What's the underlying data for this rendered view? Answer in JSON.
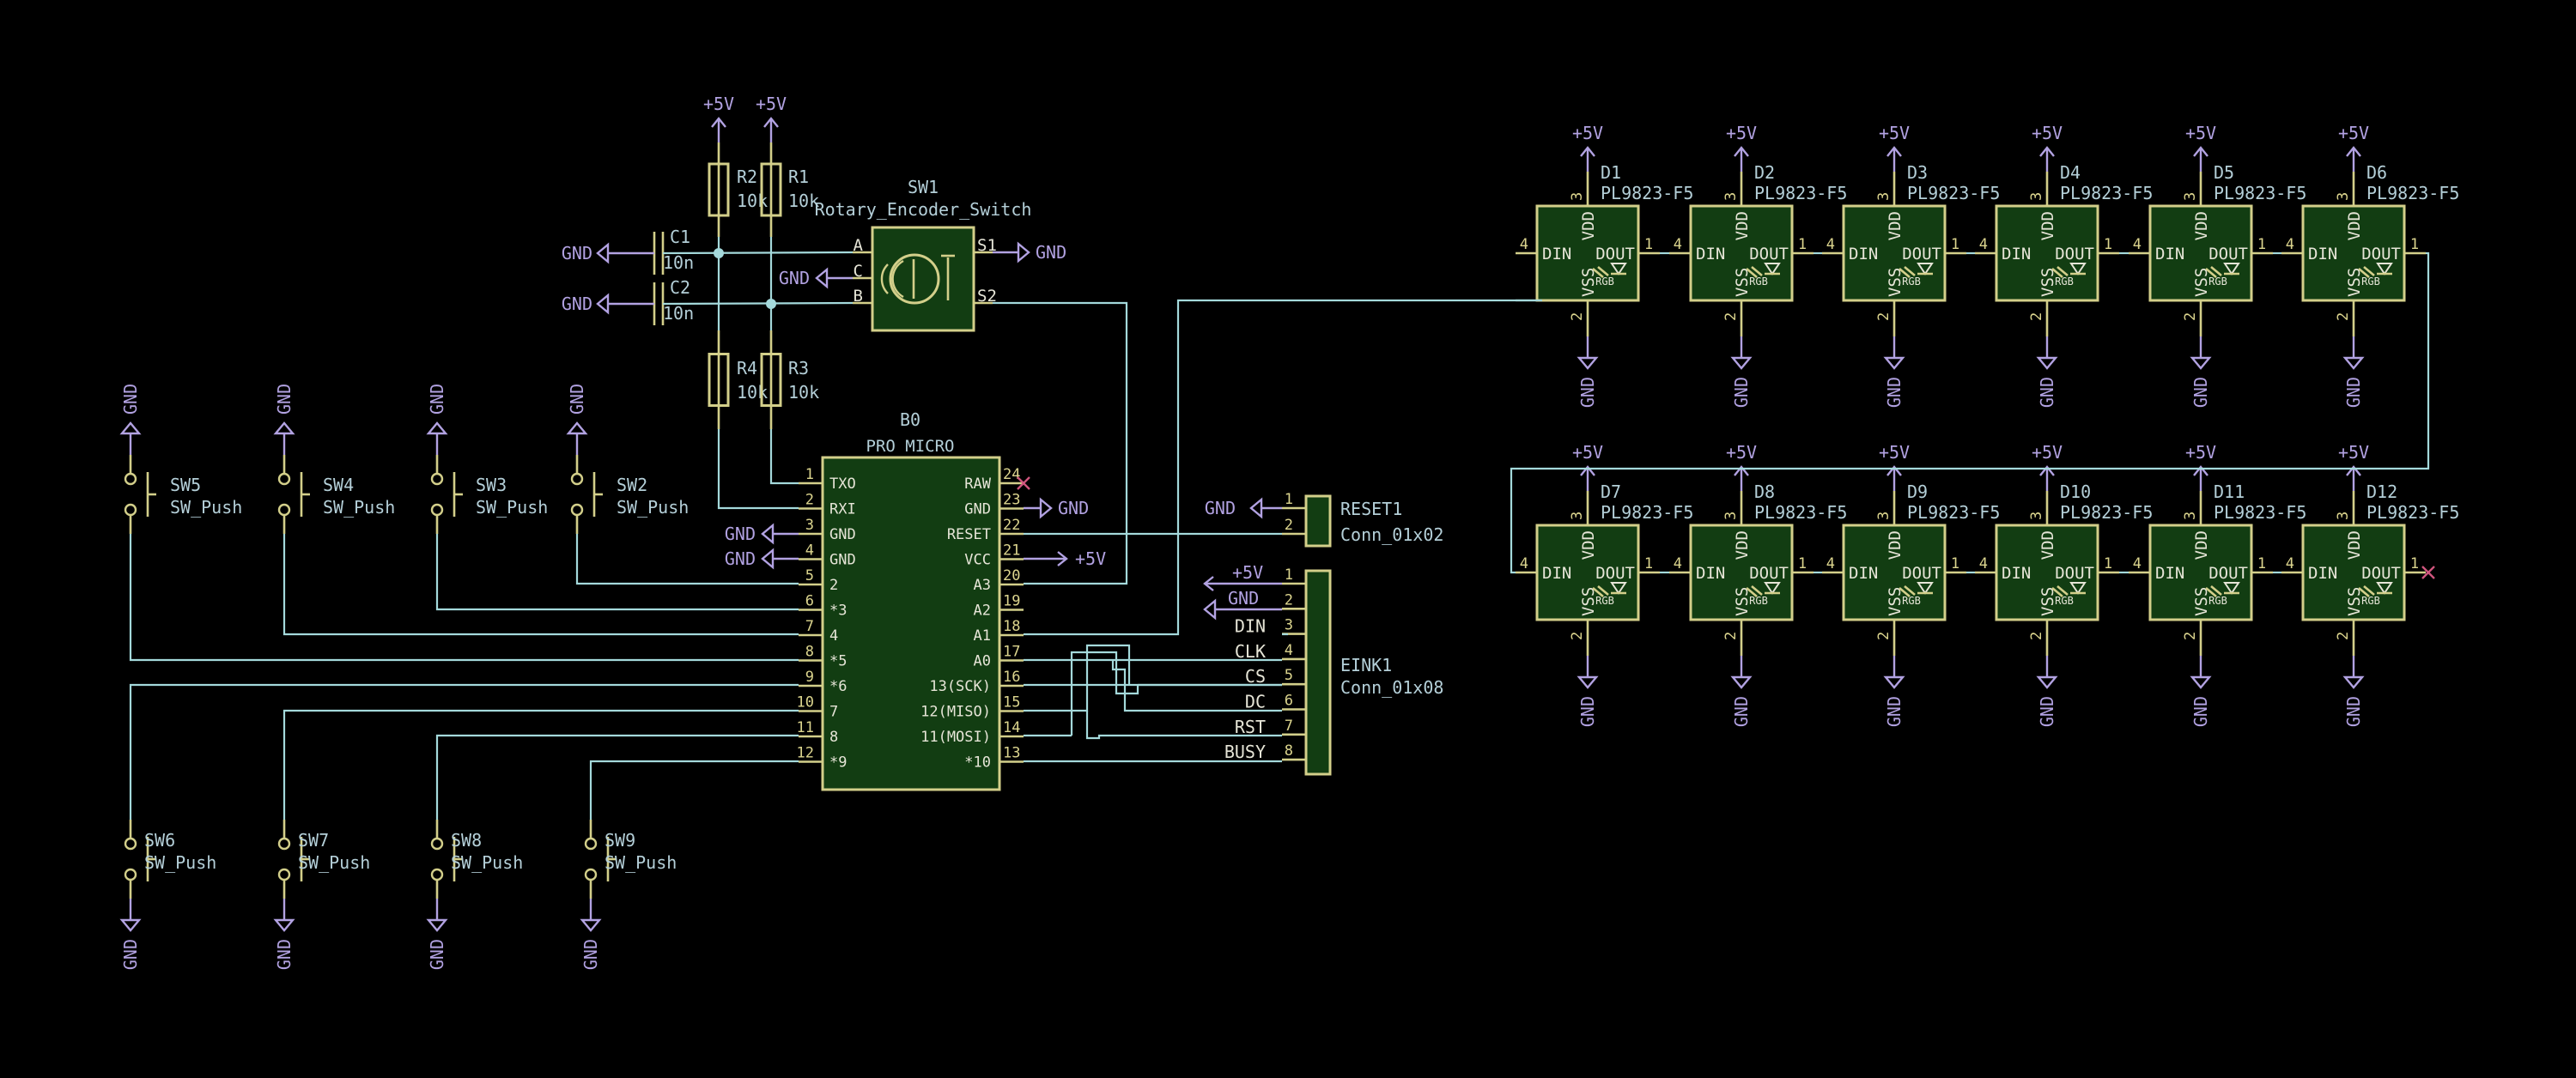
{
  "colors": {
    "background": "#000000",
    "wire": "#a4d9db",
    "component_outline": "#d3cf8a",
    "component_fill": "#123d12",
    "power_symbol": "#b2a2e2",
    "reference_text": "#b4cfd8",
    "pin_text": "#e6e5d7",
    "no_connect": "#d0567e"
  },
  "mcu": {
    "ref": "B0",
    "value": "PRO MICRO",
    "left_pins": [
      {
        "num": "1",
        "name": "TXO"
      },
      {
        "num": "2",
        "name": "RXI"
      },
      {
        "num": "3",
        "name": "GND"
      },
      {
        "num": "4",
        "name": "GND"
      },
      {
        "num": "5",
        "name": "2"
      },
      {
        "num": "6",
        "name": "*3"
      },
      {
        "num": "7",
        "name": "4"
      },
      {
        "num": "8",
        "name": "*5"
      },
      {
        "num": "9",
        "name": "*6"
      },
      {
        "num": "10",
        "name": "7"
      },
      {
        "num": "11",
        "name": "8"
      },
      {
        "num": "12",
        "name": "*9"
      }
    ],
    "right_pins": [
      {
        "num": "24",
        "name": "RAW"
      },
      {
        "num": "23",
        "name": "GND"
      },
      {
        "num": "22",
        "name": "RESET"
      },
      {
        "num": "21",
        "name": "VCC"
      },
      {
        "num": "20",
        "name": "A3"
      },
      {
        "num": "19",
        "name": "A2"
      },
      {
        "num": "18",
        "name": "A1"
      },
      {
        "num": "17",
        "name": "A0"
      },
      {
        "num": "16",
        "name": "13(SCK)"
      },
      {
        "num": "15",
        "name": "12(MISO)"
      },
      {
        "num": "14",
        "name": "11(MOSI)"
      },
      {
        "num": "13",
        "name": "*10"
      }
    ]
  },
  "encoder": {
    "ref": "SW1",
    "value": "Rotary_Encoder_Switch",
    "pins": {
      "a": "A",
      "c": "C",
      "b": "B",
      "s1": "S1",
      "s2": "S2"
    }
  },
  "resistors": [
    {
      "ref": "R2",
      "value": "10k"
    },
    {
      "ref": "R1",
      "value": "10k"
    },
    {
      "ref": "R4",
      "value": "10k"
    },
    {
      "ref": "R3",
      "value": "10k"
    }
  ],
  "capacitors": [
    {
      "ref": "C1",
      "value": "10n"
    },
    {
      "ref": "C2",
      "value": "10n"
    }
  ],
  "switches": [
    {
      "ref": "SW5",
      "value": "SW_Push"
    },
    {
      "ref": "SW4",
      "value": "SW_Push"
    },
    {
      "ref": "SW3",
      "value": "SW_Push"
    },
    {
      "ref": "SW2",
      "value": "SW_Push"
    },
    {
      "ref": "SW6",
      "value": "SW_Push"
    },
    {
      "ref": "SW7",
      "value": "SW_Push"
    },
    {
      "ref": "SW8",
      "value": "SW_Push"
    },
    {
      "ref": "SW9",
      "value": "SW_Push"
    }
  ],
  "reset_connector": {
    "ref": "RESET1",
    "value": "Conn_01x02",
    "pins": [
      "1",
      "2"
    ]
  },
  "eink_connector": {
    "ref": "EINK1",
    "value": "Conn_01x08",
    "pins": [
      {
        "num": "1",
        "net": "+5V"
      },
      {
        "num": "2",
        "net": "GND"
      },
      {
        "num": "3",
        "net": "DIN"
      },
      {
        "num": "4",
        "net": "CLK"
      },
      {
        "num": "5",
        "net": "CS"
      },
      {
        "num": "6",
        "net": "DC"
      },
      {
        "num": "7",
        "net": "RST"
      },
      {
        "num": "8",
        "net": "BUSY"
      }
    ]
  },
  "leds": {
    "value": "PL9823-F5",
    "refs": [
      "D1",
      "D2",
      "D3",
      "D4",
      "D5",
      "D6",
      "D7",
      "D8",
      "D9",
      "D10",
      "D11",
      "D12"
    ],
    "pins": {
      "din": "DIN",
      "dout": "DOUT",
      "vdd": "VDD",
      "vss": "VSS",
      "rgb": "RGB",
      "din_num": "4",
      "dout_num": "1",
      "vdd_num": "3",
      "vss_num": "2"
    }
  },
  "power_labels": {
    "vcc": "+5V",
    "gnd": "GND"
  }
}
